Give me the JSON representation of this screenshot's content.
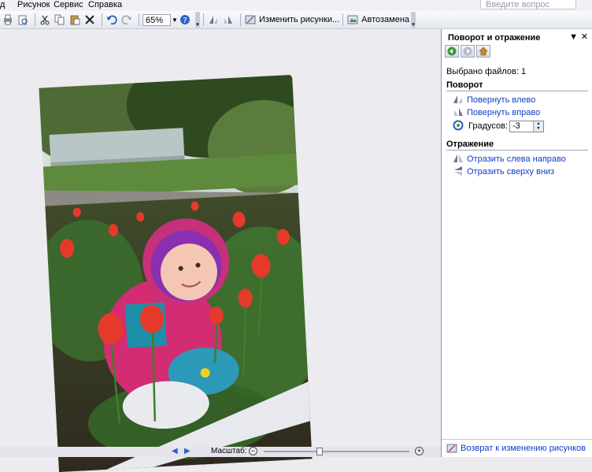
{
  "menu": {
    "items": [
      {
        "label": "д"
      },
      {
        "label": "Рисунок"
      },
      {
        "label": "Сервис"
      },
      {
        "label": "Справка"
      }
    ],
    "ask_placeholder": "Введите вопрос"
  },
  "toolbar": {
    "zoom_value": "65%",
    "edit_pictures_label": "Изменить рисунки...",
    "autocorrect_label": "Автозамена"
  },
  "statusbar": {
    "scale_label": "Масштаб:",
    "zoom_slider_fraction": 0.38
  },
  "pane": {
    "title": "Поворот и отражение",
    "selected_files": "Выбрано файлов: 1",
    "rotation_header": "Поворот",
    "rotate_left": "Повернуть влево",
    "rotate_right": "Повернуть вправо",
    "degrees_label": "Градусов:",
    "degrees_value": "-3",
    "flip_header": "Отражение",
    "flip_horizontal": "Отразить слева направо",
    "flip_vertical": "Отразить сверху вниз",
    "back_link": "Возврат к изменению рисунков"
  },
  "colors": {
    "link": "#0f3bc8",
    "pane_border": "#8e97ab"
  }
}
